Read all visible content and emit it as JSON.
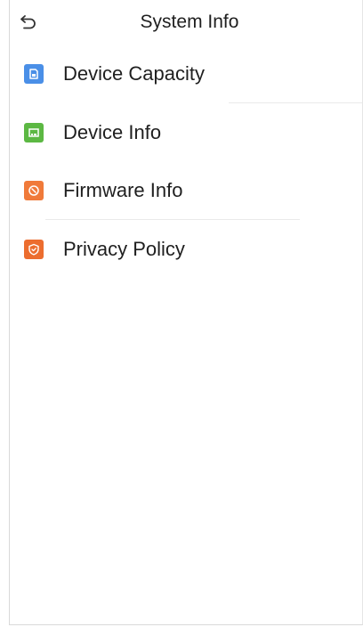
{
  "header": {
    "title": "System Info",
    "back_icon": "back-arrow-icon"
  },
  "menu": {
    "items": [
      {
        "label": "Device Capacity",
        "icon": "storage-card-icon",
        "color": "#4a8fe7"
      },
      {
        "label": "Device Info",
        "icon": "device-info-icon",
        "color": "#5cb843"
      },
      {
        "label": "Firmware Info",
        "icon": "firmware-icon",
        "color": "#f07a3a"
      },
      {
        "label": "Privacy Policy",
        "icon": "shield-icon",
        "color": "#ec6d2f"
      }
    ]
  }
}
